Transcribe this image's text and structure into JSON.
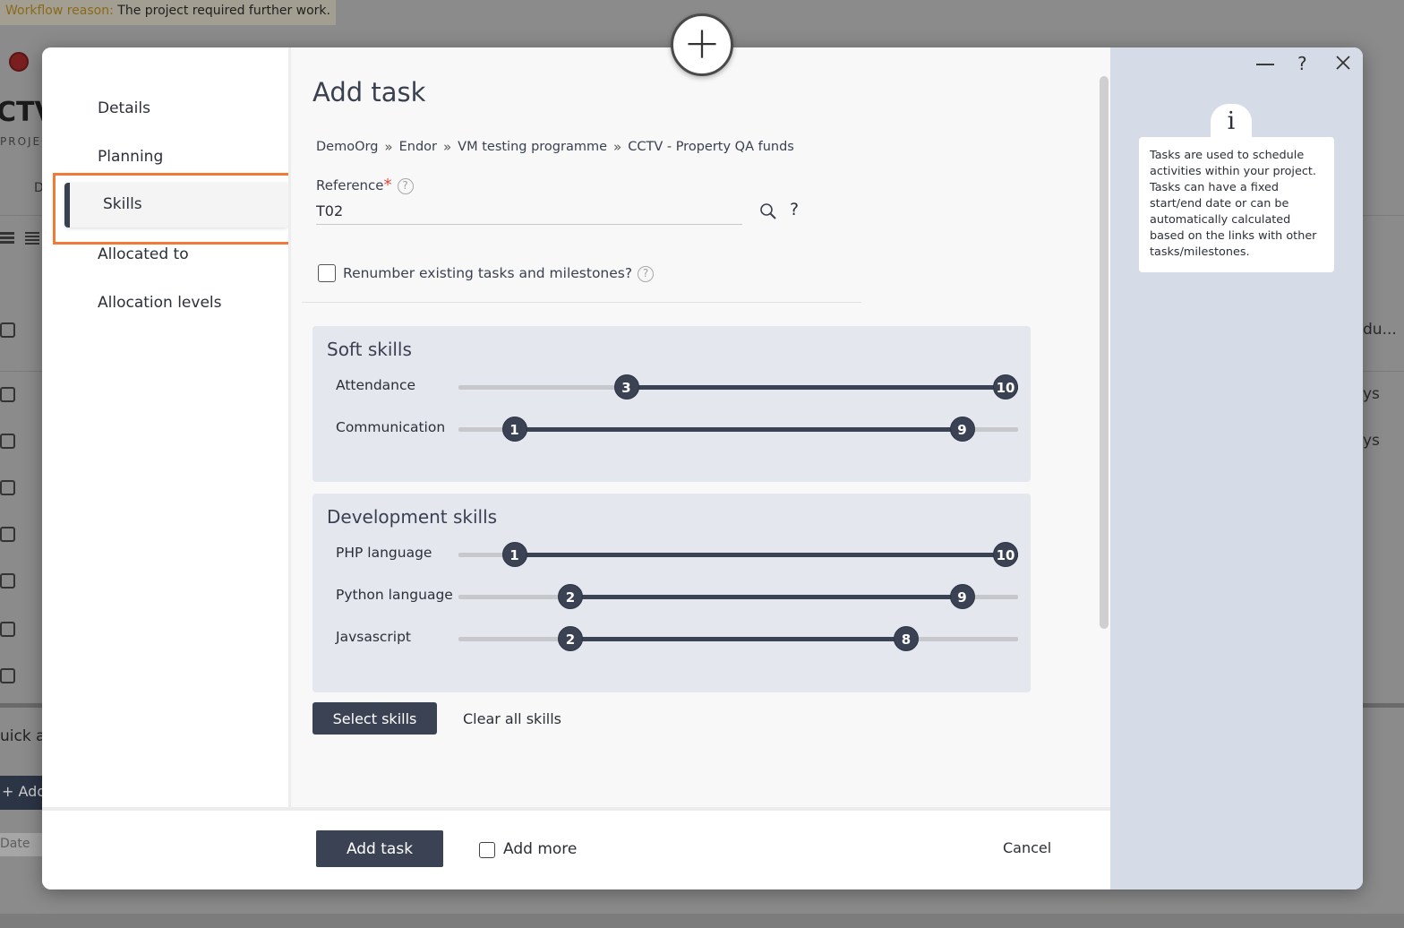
{
  "background": {
    "workflow_label": "Workflow reason:",
    "workflow_value": "The project required further work.",
    "page_title_fragment": "CTV",
    "page_subtitle_fragment": "PROJEC",
    "tab_fragment": "D",
    "right_column_header": "du...",
    "right_column_values": [
      "ys",
      "ys"
    ],
    "quick_add_fragment": "uick ac",
    "add_button_fragment": "+ Add",
    "date_fragment": "Date"
  },
  "modal": {
    "nav": {
      "items": [
        "Details",
        "Planning",
        "Skills",
        "Allocated to",
        "Allocation levels"
      ],
      "active": "Skills"
    },
    "title": "Add task",
    "breadcrumb": [
      "DemoOrg",
      "Endor",
      "VM testing programme",
      "CCTV - Property QA funds"
    ],
    "reference": {
      "label": "Reference",
      "required_mark": "*",
      "value": "T02",
      "help": "?"
    },
    "renumber": {
      "label": "Renumber existing tasks and milestones?",
      "checked": false
    },
    "skill_groups": [
      {
        "title": "Soft skills",
        "skills": [
          {
            "name": "Attendance",
            "min": 3,
            "max": 10
          },
          {
            "name": "Communication",
            "min": 1,
            "max": 9
          }
        ]
      },
      {
        "title": "Development skills",
        "skills": [
          {
            "name": "PHP language",
            "min": 1,
            "max": 10
          },
          {
            "name": "Python language",
            "min": 2,
            "max": 9
          },
          {
            "name": "Javsascript",
            "min": 2,
            "max": 8
          }
        ]
      }
    ],
    "buttons": {
      "select_skills": "Select skills",
      "clear_all_skills": "Clear all skills",
      "add_task": "Add task",
      "add_more": "Add more",
      "cancel": "Cancel"
    },
    "info": {
      "icon": "i",
      "text": "Tasks are used to schedule activities within your project. Tasks can have a fixed start/end date or can be automatically calculated based on the links with other tasks/milestones."
    },
    "window_controls": {
      "help": "?"
    }
  },
  "colors": {
    "accent_dark": "#3a4254",
    "highlight": "#f07a36",
    "required": "#e2443c",
    "info_panel": "#d6dce7"
  }
}
